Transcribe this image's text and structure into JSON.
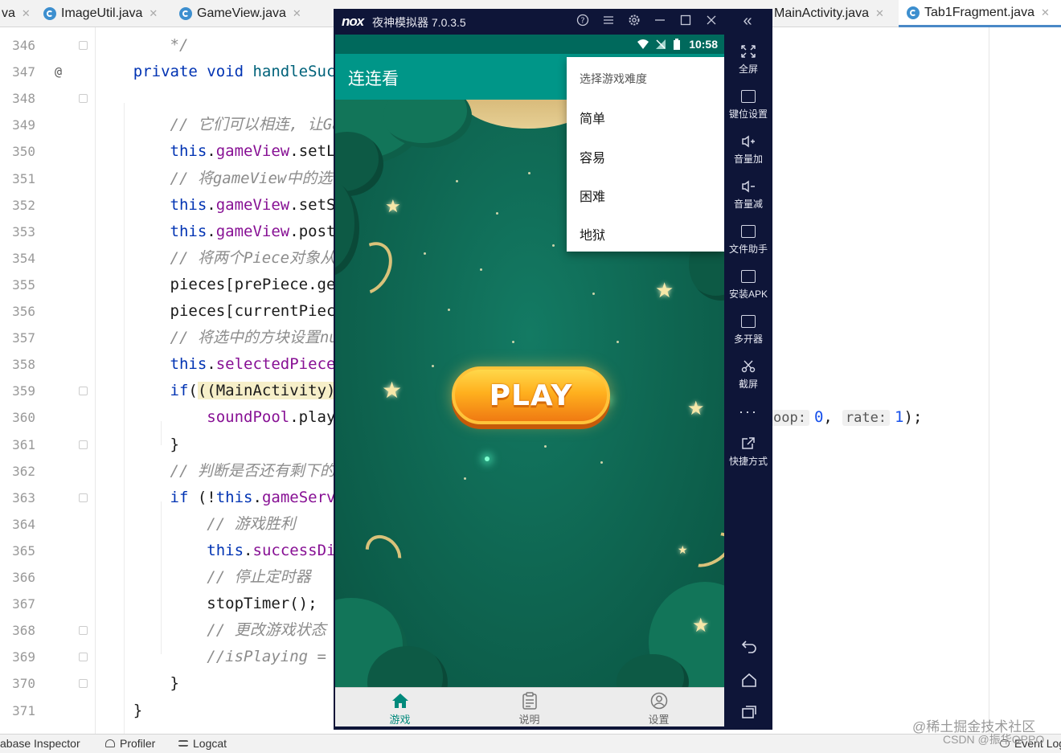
{
  "ide": {
    "tabs": [
      {
        "label": "va",
        "partial": true
      },
      {
        "label": "ImageUtil.java"
      },
      {
        "label": "GameView.java"
      },
      {
        "label": "MainActivity.java"
      },
      {
        "label": "Tab1Fragment.java",
        "active": true
      }
    ],
    "line_numbers": [
      "346",
      "347",
      "348",
      "349",
      "350",
      "351",
      "352",
      "353",
      "354",
      "355",
      "356",
      "357",
      "358",
      "359",
      "360",
      "361",
      "362",
      "363",
      "364",
      "365",
      "366",
      "367",
      "368",
      "369",
      "370",
      "371"
    ],
    "gutter_annotation": "@",
    "code_lines": [
      {
        "parts": [
          {
            "t": "        */",
            "c": "cmt"
          }
        ]
      },
      {
        "parts": [
          {
            "t": "    ",
            "c": ""
          },
          {
            "t": "private void ",
            "c": "kw"
          },
          {
            "t": "handleSucc",
            "c": "mth"
          }
        ]
      },
      {
        "parts": []
      },
      {
        "parts": [
          {
            "t": "        ",
            "c": ""
          },
          {
            "t": "// 它们可以相连, 让Gam",
            "c": "cmt"
          }
        ]
      },
      {
        "parts": [
          {
            "t": "        ",
            "c": ""
          },
          {
            "t": "this",
            "c": "kw"
          },
          {
            "t": ".",
            "c": ""
          },
          {
            "t": "gameView",
            "c": "fld"
          },
          {
            "t": ".setLi",
            "c": ""
          }
        ]
      },
      {
        "parts": [
          {
            "t": "        ",
            "c": ""
          },
          {
            "t": "// 将gameView中的选中",
            "c": "cmt"
          }
        ]
      },
      {
        "parts": [
          {
            "t": "        ",
            "c": ""
          },
          {
            "t": "this",
            "c": "kw"
          },
          {
            "t": ".",
            "c": ""
          },
          {
            "t": "gameView",
            "c": "fld"
          },
          {
            "t": ".setSe",
            "c": ""
          }
        ]
      },
      {
        "parts": [
          {
            "t": "        ",
            "c": ""
          },
          {
            "t": "this",
            "c": "kw"
          },
          {
            "t": ".",
            "c": ""
          },
          {
            "t": "gameView",
            "c": "fld"
          },
          {
            "t": ".postI",
            "c": ""
          }
        ]
      },
      {
        "parts": [
          {
            "t": "        ",
            "c": ""
          },
          {
            "t": "// 将两个Piece对象从数",
            "c": "cmt"
          }
        ]
      },
      {
        "parts": [
          {
            "t": "        pieces[prePiece.get",
            "c": ""
          }
        ]
      },
      {
        "parts": [
          {
            "t": "        pieces[currentPiece",
            "c": ""
          }
        ]
      },
      {
        "parts": [
          {
            "t": "        ",
            "c": ""
          },
          {
            "t": "// 将选中的方块设置nul",
            "c": "cmt"
          }
        ]
      },
      {
        "parts": [
          {
            "t": "        ",
            "c": ""
          },
          {
            "t": "this",
            "c": "kw"
          },
          {
            "t": ".",
            "c": ""
          },
          {
            "t": "selectedPiece",
            "c": "fld"
          },
          {
            "t": " =",
            "c": ""
          }
        ]
      },
      {
        "parts": [
          {
            "t": "        ",
            "c": ""
          },
          {
            "t": "if",
            "c": "kw"
          },
          {
            "t": "(",
            "c": ""
          },
          {
            "t": "((MainActivity)g",
            "c": "hl"
          }
        ]
      },
      {
        "parts": [
          {
            "t": "            ",
            "c": ""
          },
          {
            "t": "soundPool",
            "c": "fld"
          },
          {
            "t": ".play(",
            "c": ""
          }
        ]
      },
      {
        "parts": [
          {
            "t": "        }",
            "c": ""
          }
        ]
      },
      {
        "parts": [
          {
            "t": "        ",
            "c": ""
          },
          {
            "t": "// 判断是否还有剩下的方",
            "c": "cmt"
          }
        ]
      },
      {
        "parts": [
          {
            "t": "        ",
            "c": ""
          },
          {
            "t": "if",
            "c": "kw"
          },
          {
            "t": " (!",
            "c": ""
          },
          {
            "t": "this",
            "c": "kw"
          },
          {
            "t": ".",
            "c": ""
          },
          {
            "t": "gameServi",
            "c": "fld"
          }
        ]
      },
      {
        "parts": [
          {
            "t": "            ",
            "c": ""
          },
          {
            "t": "// 游戏胜利",
            "c": "cmt"
          }
        ]
      },
      {
        "parts": [
          {
            "t": "            ",
            "c": ""
          },
          {
            "t": "this",
            "c": "kw"
          },
          {
            "t": ".",
            "c": ""
          },
          {
            "t": "successDia",
            "c": "fld"
          }
        ]
      },
      {
        "parts": [
          {
            "t": "            ",
            "c": ""
          },
          {
            "t": "// 停止定时器",
            "c": "cmt"
          }
        ]
      },
      {
        "parts": [
          {
            "t": "            stopTimer();",
            "c": ""
          }
        ]
      },
      {
        "parts": [
          {
            "t": "            ",
            "c": ""
          },
          {
            "t": "// 更改游戏状态",
            "c": "cmt"
          }
        ]
      },
      {
        "parts": [
          {
            "t": "            ",
            "c": ""
          },
          {
            "t": "//isPlaying = f",
            "c": "cmt"
          }
        ]
      },
      {
        "parts": [
          {
            "t": "        }",
            "c": ""
          }
        ]
      },
      {
        "parts": [
          {
            "t": "    }",
            "c": ""
          }
        ]
      }
    ],
    "line360_suffix": {
      "hint1": "oop:",
      "val1": "0",
      "sep": ",",
      "hint2": "rate:",
      "val2": "1",
      "end": ");"
    },
    "bottom_tools": [
      {
        "label": "abase Inspector"
      },
      {
        "label": "Profiler"
      },
      {
        "label": "Logcat"
      },
      {
        "label": "Event Log"
      }
    ],
    "watermark": "@稀土掘金技术社区",
    "watermark2": "CSDN @振华OPPO"
  },
  "emulator": {
    "logo": "nox",
    "title": "夜神模拟器 7.0.3.5",
    "titlebar_buttons": [
      "help-icon",
      "menu-icon",
      "settings-icon",
      "minimize-icon",
      "maximize-icon",
      "close-icon"
    ],
    "status_time": "10:58",
    "app_title": "连连看",
    "popup": {
      "title": "选择游戏难度",
      "items": [
        "简单",
        "容易",
        "困难",
        "地狱"
      ]
    },
    "play_label": "PLAY",
    "bottom_nav": [
      {
        "label": "游戏",
        "icon": "home-icon",
        "active": true
      },
      {
        "label": "说明",
        "icon": "clipboard-icon"
      },
      {
        "label": "设置",
        "icon": "profile-icon"
      }
    ],
    "sidebar": [
      {
        "label": "全屏",
        "icon": "fullscreen-icon"
      },
      {
        "label": "键位设置",
        "icon": "keyboard-icon"
      },
      {
        "label": "音量加",
        "icon": "volume-up-icon"
      },
      {
        "label": "音量减",
        "icon": "volume-down-icon"
      },
      {
        "label": "文件助手",
        "icon": "file-helper-icon"
      },
      {
        "label": "安装APK",
        "icon": "install-apk-icon"
      },
      {
        "label": "多开器",
        "icon": "multi-instance-icon"
      },
      {
        "label": "截屏",
        "icon": "screenshot-icon"
      },
      {
        "label": "",
        "icon": "more-icon"
      },
      {
        "label": "快捷方式",
        "icon": "shortcut-icon"
      }
    ],
    "nav_buttons": [
      "back-icon",
      "home-icon",
      "recents-icon"
    ],
    "colors": {
      "appbar": "#009688",
      "statusbar": "#00695c",
      "nav_active": "#00897b",
      "emu_chrome": "#0e1538"
    }
  }
}
